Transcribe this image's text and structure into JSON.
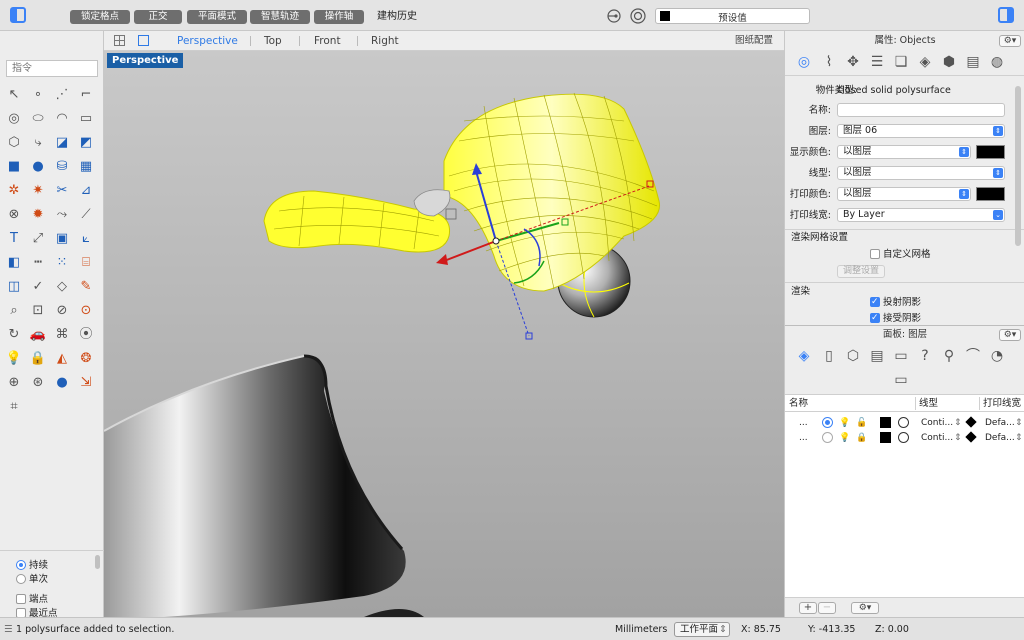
{
  "toolbar": {
    "buttons": [
      "锁定格点",
      "正交",
      "平面模式",
      "智慧轨迹",
      "操作轴"
    ],
    "history_label": "建构历史",
    "preset": "预设值"
  },
  "left": {
    "command_placeholder": "指令",
    "snaps": {
      "persistent": "持续",
      "single": "单次",
      "endpoint": "端点",
      "nearest": "最近点"
    }
  },
  "viewport": {
    "tabs": [
      "Perspective",
      "Top",
      "Front",
      "Right"
    ],
    "layout_label": "图纸配置",
    "active_label": "Perspective"
  },
  "status": {
    "message": "1 polysurface added to selection.",
    "units": "Millimeters",
    "cplane": "工作平面",
    "x": "X: 85.75",
    "y": "Y: -413.35",
    "z": "Z: 0.00"
  },
  "properties": {
    "title": "属性: Objects",
    "object_type_label": "物件类型:",
    "object_type_value": "closed solid polysurface",
    "name_label": "名称:",
    "name_value": "",
    "layer_label": "图层:",
    "layer_value": "图层 06",
    "display_color_label": "显示颜色:",
    "display_color_value": "以图层",
    "linetype_label": "线型:",
    "linetype_value": "以图层",
    "print_color_label": "打印颜色:",
    "print_color_value": "以图层",
    "print_width_label": "打印线宽:",
    "print_width_value": "By Layer",
    "render_mesh_section": "渲染网格设置",
    "custom_mesh_label": "自定义网格",
    "adjust_button": "调整设置",
    "render_section": "渲染",
    "cast_shadows_label": "投射阴影",
    "receive_shadows_label": "接受阴影"
  },
  "layers_panel": {
    "title": "面板: 图层",
    "headers": {
      "name": "名称",
      "linetype": "线型",
      "print_width": "打印线宽"
    },
    "rows": [
      {
        "name": "...",
        "linetype": "Conti...",
        "print_width": "Defa..."
      },
      {
        "name": "...",
        "linetype": "Conti...",
        "print_width": "Defa..."
      }
    ]
  },
  "colors": {
    "accent": "#3b82f6",
    "selection": "#ffff00",
    "viewport_label_bg": "#1a5fa6"
  },
  "icons": {
    "object_tabs": [
      "object-properties-icon",
      "curve-icon",
      "gumball-icon",
      "layers-stack-icon",
      "note-icon",
      "texture-icon",
      "box-icon",
      "doc-icon",
      "render-icon",
      "sphere-icon"
    ],
    "layer_panel_icons": [
      "layers-icon",
      "page-icon",
      "cube-icon",
      "notepad-icon",
      "display-icon",
      "help-icon",
      "brush-icon",
      "camera-icon",
      "folder-icon"
    ]
  }
}
